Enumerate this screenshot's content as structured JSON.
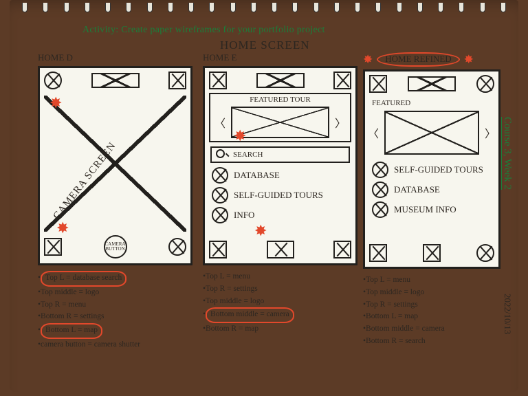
{
  "header_green": "Activity: Create paper wireframes for your portfolio project",
  "header_black": "HOME SCREEN",
  "side_course": "Course 3, Week 2",
  "side_date": "2022/10/13",
  "colA": {
    "title": "HOME D",
    "camera_screen": "CAMERA  SCREEN",
    "camera_button": "CAMERA BUTTON",
    "notes": [
      "Top L = database search",
      "Top middle = logo",
      "Top R = menu",
      "Bottom R = settings",
      "Bottom L = map",
      "camera button = camera shutter"
    ],
    "circled_lines": [
      0,
      4
    ]
  },
  "colB": {
    "title": "HOME E",
    "featured": "FEATURED TOUR",
    "search": "SEARCH",
    "options": [
      "DATABASE",
      "SELF-GUIDED TOURS",
      "INFO"
    ],
    "notes": [
      "Top L = menu",
      "Top R = settings",
      "Top middle = logo",
      "Bottom middle = camera",
      "Bottom R = map"
    ],
    "circled_lines": [
      3
    ]
  },
  "colC": {
    "title": "HOME REFINED",
    "featured": "FEATURED",
    "options": [
      "SELF-GUIDED TOURS",
      "DATABASE",
      "MUSEUM INFO"
    ],
    "notes": [
      "Top L = menu",
      "Top middle = logo",
      "Top R = settings",
      "Bottom L = map",
      "Bottom middle = camera",
      "Bottom R = search"
    ]
  }
}
